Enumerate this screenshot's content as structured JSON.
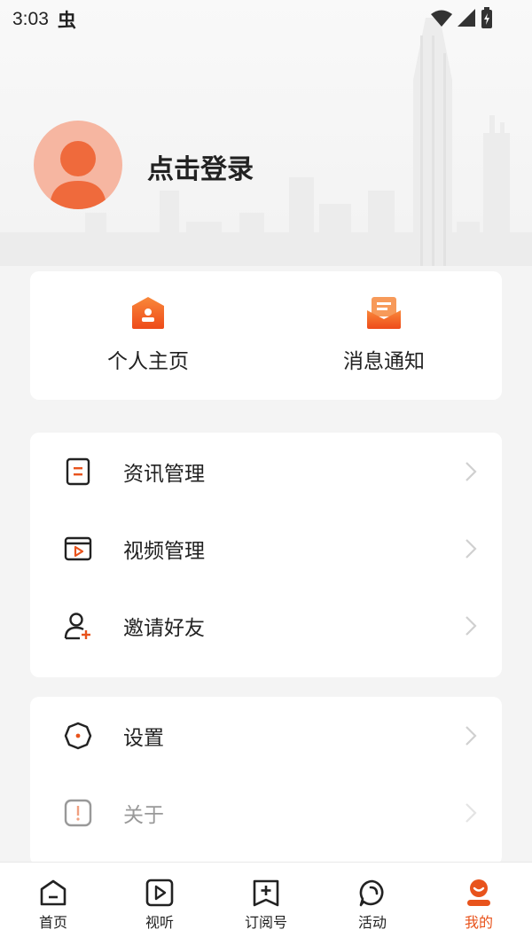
{
  "status": {
    "time": "3:03",
    "bug_glyph": "虫"
  },
  "profile": {
    "login_label": "点击登录"
  },
  "quick_actions": [
    {
      "label": "个人主页",
      "icon": "home-profile-icon"
    },
    {
      "label": "消息通知",
      "icon": "message-envelope-icon"
    }
  ],
  "menu_group_1": [
    {
      "label": "资讯管理",
      "icon": "document-icon"
    },
    {
      "label": "视频管理",
      "icon": "video-icon"
    },
    {
      "label": "邀请好友",
      "icon": "invite-user-icon"
    }
  ],
  "menu_group_2": [
    {
      "label": "设置",
      "icon": "settings-icon"
    },
    {
      "label": "关于",
      "icon": "about-icon"
    }
  ],
  "tabs": [
    {
      "label": "首页",
      "icon": "home-icon"
    },
    {
      "label": "视听",
      "icon": "play-icon"
    },
    {
      "label": "订阅号",
      "icon": "subscribe-icon"
    },
    {
      "label": "活动",
      "icon": "chat-icon"
    },
    {
      "label": "我的",
      "icon": "me-icon",
      "active": true
    }
  ],
  "colors": {
    "accent": "#e8531c",
    "background": "#f4f4f4"
  }
}
